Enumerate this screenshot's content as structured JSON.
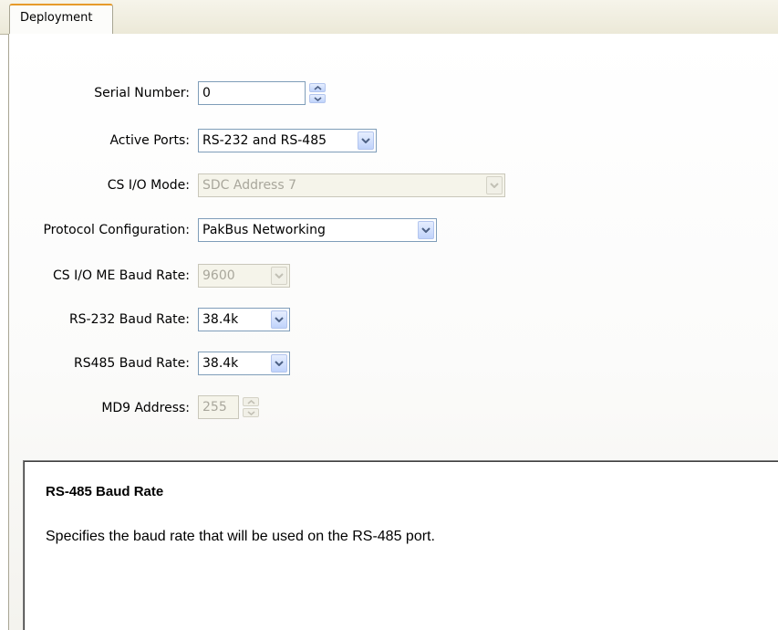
{
  "tabs": [
    {
      "label": "Deployment",
      "active": true
    }
  ],
  "colors": {
    "accent": "#e69a2a",
    "field_border": "#7f9db9",
    "disabled_text": "#a9a79c"
  },
  "form": {
    "serial_number": {
      "label": "Serial Number:",
      "value": "0",
      "control": "spinner",
      "enabled": true
    },
    "active_ports": {
      "label": "Active Ports:",
      "value": "RS-232 and RS-485",
      "control": "dropdown",
      "enabled": true
    },
    "cs_io_mode": {
      "label": "CS I/O Mode:",
      "value": "SDC Address 7",
      "control": "dropdown",
      "enabled": false
    },
    "protocol_configuration": {
      "label": "Protocol Configuration:",
      "value": "PakBus Networking",
      "control": "dropdown",
      "enabled": true
    },
    "cs_io_me_baud_rate": {
      "label": "CS I/O ME Baud Rate:",
      "value": "9600",
      "control": "dropdown",
      "enabled": false
    },
    "rs232_baud_rate": {
      "label": "RS-232 Baud Rate:",
      "value": "38.4k",
      "control": "dropdown",
      "enabled": true
    },
    "rs485_baud_rate": {
      "label": "RS485 Baud Rate:",
      "value": "38.4k",
      "control": "dropdown",
      "enabled": true
    },
    "md9_address": {
      "label": "MD9 Address:",
      "value": "255",
      "control": "spinner",
      "enabled": false
    }
  },
  "help": {
    "title": "RS-485 Baud Rate",
    "body": "Specifies the baud rate that will be used on the RS-485 port."
  },
  "icons": [
    "spin-up-icon",
    "spin-down-icon",
    "chevron-down-icon"
  ]
}
